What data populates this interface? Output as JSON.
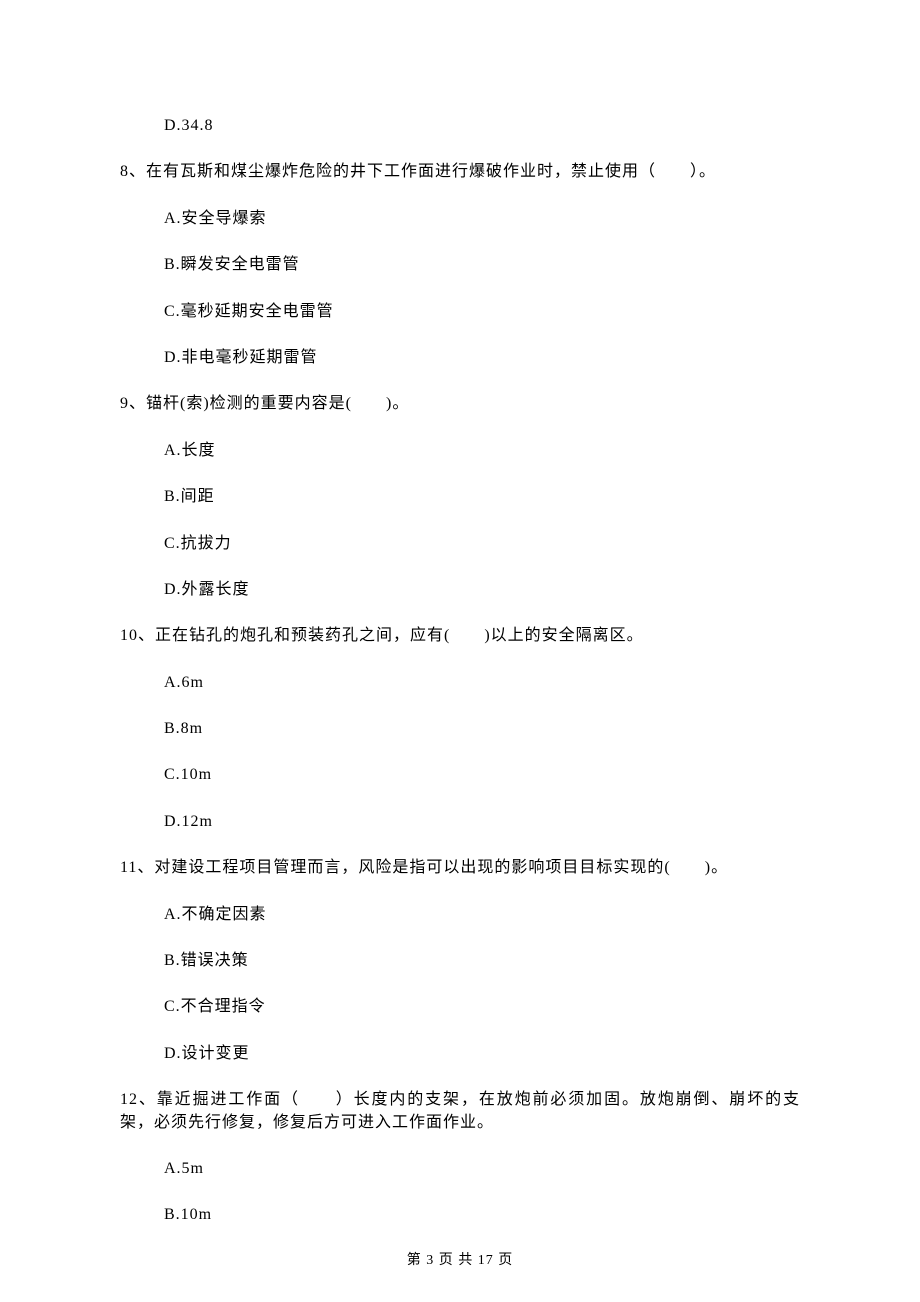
{
  "q7": {
    "options": {
      "D": "D.34.8"
    }
  },
  "q8": {
    "text": "8、在有瓦斯和煤尘爆炸危险的井下工作面进行爆破作业时，禁止使用（　　）。",
    "options": {
      "A": "A.安全导爆索",
      "B": "B.瞬发安全电雷管",
      "C": "C.毫秒延期安全电雷管",
      "D": "D.非电毫秒延期雷管"
    }
  },
  "q9": {
    "text": "9、锚杆(索)检测的重要内容是(　　)。",
    "options": {
      "A": "A.长度",
      "B": "B.间距",
      "C": "C.抗拔力",
      "D": "D.外露长度"
    }
  },
  "q10": {
    "text": "10、正在钻孔的炮孔和预装药孔之间，应有(　　)以上的安全隔离区。",
    "options": {
      "A": "A.6m",
      "B": "B.8m",
      "C": "C.10m",
      "D": "D.12m"
    }
  },
  "q11": {
    "text": "11、对建设工程项目管理而言，风险是指可以出现的影响项目目标实现的(　　)。",
    "options": {
      "A": "A.不确定因素",
      "B": "B.错误决策",
      "C": "C.不合理指令",
      "D": "D.设计变更"
    }
  },
  "q12": {
    "text": "12、靠近掘进工作面（　　）长度内的支架，在放炮前必须加固。放炮崩倒、崩坏的支架，必须先行修复，修复后方可进入工作面作业。",
    "options": {
      "A": "A.5m",
      "B": "B.10m"
    }
  },
  "footer": "第 3 页 共 17 页"
}
